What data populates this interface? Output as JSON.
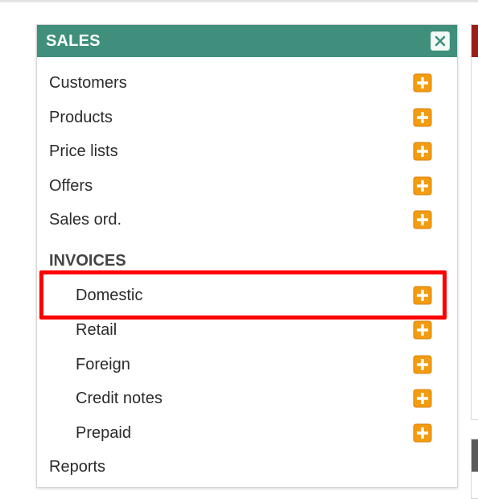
{
  "sales_panel": {
    "title": "SALES",
    "items": [
      {
        "label": "Customers"
      },
      {
        "label": "Products"
      },
      {
        "label": "Price lists"
      },
      {
        "label": "Offers"
      },
      {
        "label": "Sales ord."
      }
    ],
    "invoices": {
      "title": "INVOICES",
      "items": [
        {
          "label": "Domestic"
        },
        {
          "label": "Retail"
        },
        {
          "label": "Foreign"
        },
        {
          "label": "Credit notes"
        },
        {
          "label": "Prepaid"
        }
      ]
    },
    "reports_label": "Reports"
  },
  "colors": {
    "header": "#3f8f7c",
    "add_icon": "#f39c12",
    "highlight": "#ff0000",
    "side_panel_red": "#9a1f1a",
    "side_panel_gray": "#5a5a5a"
  },
  "icons": {
    "close": "close-icon",
    "add": "plus-square-icon"
  }
}
